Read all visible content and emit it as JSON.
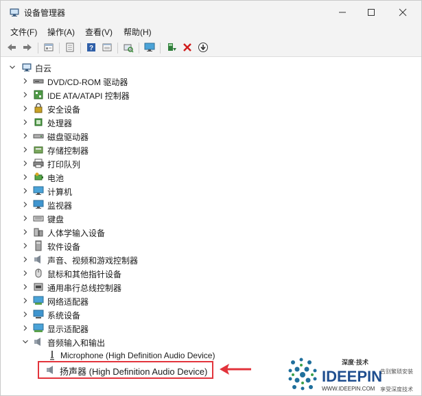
{
  "window": {
    "title": "设备管理器"
  },
  "menu": {
    "items": [
      "文件(F)",
      "操作(A)",
      "查看(V)",
      "帮助(H)"
    ]
  },
  "toolbar": {
    "icons": [
      "back-arrow-icon",
      "forward-arrow-icon",
      "properties-icon",
      "list-icon",
      "help-icon",
      "view-icon",
      "scan-hardware-icon",
      "monitor-icon",
      "add-driver-icon",
      "uninstall-icon",
      "update-icon"
    ]
  },
  "tree": {
    "root": "白云",
    "categories": [
      {
        "label": "DVD/CD-ROM 驱动器",
        "icon": "dvd-drive-icon",
        "expanded": false
      },
      {
        "label": "IDE ATA/ATAPI 控制器",
        "icon": "ide-controller-icon",
        "expanded": false
      },
      {
        "label": "安全设备",
        "icon": "security-device-icon",
        "expanded": false
      },
      {
        "label": "处理器",
        "icon": "processor-icon",
        "expanded": false
      },
      {
        "label": "磁盘驱动器",
        "icon": "disk-drive-icon",
        "expanded": false
      },
      {
        "label": "存储控制器",
        "icon": "storage-controller-icon",
        "expanded": false
      },
      {
        "label": "打印队列",
        "icon": "printer-icon",
        "expanded": false
      },
      {
        "label": "电池",
        "icon": "battery-icon",
        "expanded": false
      },
      {
        "label": "计算机",
        "icon": "computer-icon",
        "expanded": false
      },
      {
        "label": "监视器",
        "icon": "monitor-icon",
        "expanded": false
      },
      {
        "label": "键盘",
        "icon": "keyboard-icon",
        "expanded": false
      },
      {
        "label": "人体学输入设备",
        "icon": "hid-icon",
        "expanded": false
      },
      {
        "label": "软件设备",
        "icon": "software-device-icon",
        "expanded": false
      },
      {
        "label": "声音、视频和游戏控制器",
        "icon": "sound-icon",
        "expanded": false
      },
      {
        "label": "鼠标和其他指针设备",
        "icon": "mouse-icon",
        "expanded": false
      },
      {
        "label": "通用串行总线控制器",
        "icon": "usb-icon",
        "expanded": false
      },
      {
        "label": "网络适配器",
        "icon": "network-adapter-icon",
        "expanded": false
      },
      {
        "label": "系统设备",
        "icon": "system-device-icon",
        "expanded": false
      },
      {
        "label": "显示适配器",
        "icon": "display-adapter-icon",
        "expanded": false
      },
      {
        "label": "音频输入和输出",
        "icon": "audio-io-icon",
        "expanded": true
      }
    ],
    "children": [
      {
        "label": "Microphone (High Definition Audio Device)",
        "icon": "microphone-icon"
      },
      {
        "label": "扬声器 (High Definition Audio Device)",
        "icon": "speaker-icon"
      }
    ]
  },
  "watermark": {
    "top": "深度·技术",
    "brand": "IDEEPIN",
    "url": "WWW.IDEEPIN.COM",
    "right1": "告别繁琐安装",
    "right2": "享受深度技术"
  },
  "colors": {
    "highlight": "#e2333b",
    "brand": "#1f4e8f"
  }
}
